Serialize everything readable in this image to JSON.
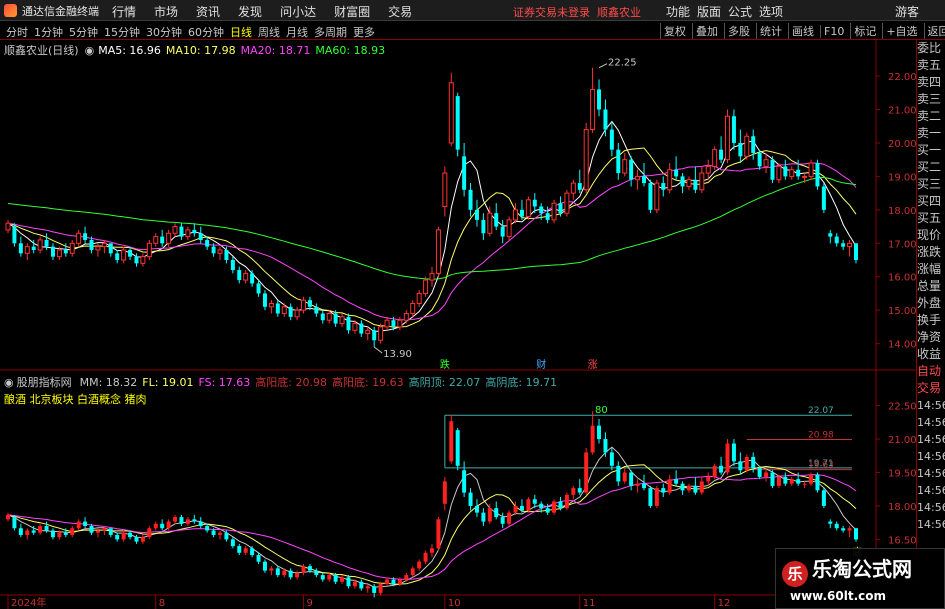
{
  "app": {
    "name": "通达信金融终端",
    "notice": "证券交易未登录",
    "stock_link": "顺鑫农业",
    "guest": "游客"
  },
  "menu": [
    "行情",
    "市场",
    "资讯",
    "发现",
    "问小达",
    "财富圈",
    "交易"
  ],
  "right_menu": [
    "功能",
    "版面",
    "公式",
    "选项"
  ],
  "periods": [
    {
      "label": "分时",
      "on": false
    },
    {
      "label": "1分钟",
      "on": false
    },
    {
      "label": "5分钟",
      "on": false
    },
    {
      "label": "15分钟",
      "on": false
    },
    {
      "label": "30分钟",
      "on": false
    },
    {
      "label": "60分钟",
      "on": false
    },
    {
      "label": "日线",
      "on": true
    },
    {
      "label": "周线",
      "on": false
    },
    {
      "label": "月线",
      "on": false
    },
    {
      "label": "多周期",
      "on": false
    },
    {
      "label": "更多",
      "on": false
    }
  ],
  "toolbar": [
    "复权",
    "叠加",
    "多股",
    "统计",
    "画线",
    "F10",
    "标记",
    "+自选",
    "返回"
  ],
  "main_legend": {
    "title": "顺鑫农业(日线)",
    "items": [
      {
        "label": "MA5: 16.96",
        "color": "#ffffff"
      },
      {
        "label": "MA10: 17.98",
        "color": "#ffff66"
      },
      {
        "label": "MA20: 18.71",
        "color": "#ff44ff"
      },
      {
        "label": "MA60: 18.93",
        "color": "#33ff33"
      }
    ]
  },
  "indicator_legend": {
    "title": "股朋指标网",
    "items": [
      {
        "label": "MM: 18.32",
        "color": "#c8c8c8"
      },
      {
        "label": "FL: 19.01",
        "color": "#ffff66"
      },
      {
        "label": "FS: 17.63",
        "color": "#ff44ff"
      },
      {
        "label": "高阳底: 20.98",
        "color": "#c83232"
      },
      {
        "label": "高阳底: 19.63",
        "color": "#c83232"
      },
      {
        "label": "高阴顶: 22.07",
        "color": "#44aaaa"
      },
      {
        "label": "高阴底: 19.71",
        "color": "#44aaaa"
      }
    ],
    "sub": "酿酒 北京板块 白酒概念 猪肉"
  },
  "right_panel": [
    {
      "label": "委比",
      "red": false
    },
    {
      "label": "卖五",
      "red": false
    },
    {
      "label": "卖四",
      "red": false
    },
    {
      "label": "卖三",
      "red": false
    },
    {
      "label": "卖二",
      "red": false
    },
    {
      "label": "卖一",
      "red": false
    },
    {
      "label": "买一",
      "red": false
    },
    {
      "label": "买二",
      "red": false
    },
    {
      "label": "买三",
      "red": false
    },
    {
      "label": "买四",
      "red": false
    },
    {
      "label": "买五",
      "red": false
    },
    {
      "label": "现价",
      "red": false
    },
    {
      "label": "涨跌",
      "red": false
    },
    {
      "label": "涨幅",
      "red": false
    },
    {
      "label": "总量",
      "red": false
    },
    {
      "label": "外盘",
      "red": false
    },
    {
      "label": "换手",
      "red": false
    },
    {
      "label": "净资",
      "red": false
    },
    {
      "label": "收益",
      "red": false
    },
    {
      "label": "自动",
      "red": true
    },
    {
      "label": "交易",
      "red": true
    },
    {
      "label": "14:56",
      "red": false,
      "sm": true
    },
    {
      "label": "14:56",
      "red": false,
      "sm": true
    },
    {
      "label": "14:56",
      "red": false,
      "sm": true
    },
    {
      "label": "14:56",
      "red": false,
      "sm": true
    },
    {
      "label": "14:56",
      "red": false,
      "sm": true
    },
    {
      "label": "14:56",
      "red": false,
      "sm": true
    },
    {
      "label": "14:56",
      "red": false,
      "sm": true
    },
    {
      "label": "14:56",
      "red": false,
      "sm": true
    }
  ],
  "chart_data": [
    {
      "type": "candlestick",
      "title": "顺鑫农业(日线)",
      "ylim": [
        13.6,
        22.6
      ],
      "yticks": [
        14.0,
        15.0,
        16.0,
        17.0,
        18.0,
        19.0,
        20.0,
        21.0,
        22.0
      ],
      "ytick_labels": [
        "14.00",
        "15.00",
        "16.00",
        "17.00",
        "18.00",
        "19.00",
        "20.00",
        "21.00",
        "22.00"
      ],
      "x_labels": [
        {
          "i": 0,
          "text": "2024年"
        },
        {
          "i": 23,
          "text": "8"
        },
        {
          "i": 46,
          "text": "9"
        },
        {
          "i": 68,
          "text": "10"
        },
        {
          "i": 89,
          "text": "11"
        },
        {
          "i": 110,
          "text": "12"
        }
      ],
      "annotations": [
        {
          "i": 57,
          "price": 13.9,
          "text": "13.90",
          "dir": "low"
        },
        {
          "i": 92,
          "price": 22.25,
          "text": "22.25",
          "dir": "high"
        }
      ],
      "markers": [
        {
          "i": 68,
          "text": "跌",
          "color": "#33ff33"
        },
        {
          "i": 83,
          "text": "财",
          "color": "#44aaff"
        },
        {
          "i": 91,
          "text": "涨",
          "color": "#ff4a4a"
        }
      ],
      "ma_series": [
        {
          "name": "MA5",
          "color": "#ffffff",
          "period": 5
        },
        {
          "name": "MA10",
          "color": "#ffff66",
          "period": 10
        },
        {
          "name": "MA20",
          "color": "#ff44ff",
          "period": 20
        },
        {
          "name": "MA60",
          "color": "#33ff33",
          "period": 60
        }
      ],
      "ma60_seed": 18.2,
      "ohlc": [
        [
          17.4,
          17.7,
          17.3,
          17.6
        ],
        [
          17.5,
          17.6,
          16.9,
          17.0
        ],
        [
          17.0,
          17.2,
          16.6,
          16.7
        ],
        [
          16.7,
          17.0,
          16.5,
          16.9
        ],
        [
          16.9,
          17.1,
          16.7,
          16.8
        ],
        [
          16.8,
          17.2,
          16.7,
          17.1
        ],
        [
          17.1,
          17.3,
          16.8,
          16.9
        ],
        [
          16.9,
          17.0,
          16.5,
          16.6
        ],
        [
          16.6,
          16.9,
          16.5,
          16.8
        ],
        [
          16.8,
          17.0,
          16.6,
          16.7
        ],
        [
          16.7,
          17.1,
          16.6,
          17.0
        ],
        [
          17.0,
          17.4,
          16.9,
          17.3
        ],
        [
          17.3,
          17.5,
          17.0,
          17.1
        ],
        [
          17.1,
          17.2,
          16.7,
          16.8
        ],
        [
          16.8,
          17.0,
          16.6,
          16.9
        ],
        [
          16.9,
          17.1,
          16.7,
          17.0
        ],
        [
          17.0,
          17.0,
          16.6,
          16.7
        ],
        [
          16.7,
          16.8,
          16.4,
          16.5
        ],
        [
          16.5,
          16.9,
          16.4,
          16.8
        ],
        [
          16.8,
          16.9,
          16.5,
          16.6
        ],
        [
          16.6,
          16.7,
          16.3,
          16.4
        ],
        [
          16.4,
          16.7,
          16.3,
          16.6
        ],
        [
          16.6,
          17.1,
          16.5,
          17.0
        ],
        [
          17.0,
          17.3,
          16.9,
          17.2
        ],
        [
          17.2,
          17.4,
          16.9,
          17.0
        ],
        [
          17.0,
          17.4,
          16.9,
          17.3
        ],
        [
          17.3,
          17.6,
          17.2,
          17.5
        ],
        [
          17.5,
          17.6,
          17.1,
          17.2
        ],
        [
          17.2,
          17.5,
          17.1,
          17.4
        ],
        [
          17.4,
          17.6,
          17.2,
          17.3
        ],
        [
          17.3,
          17.5,
          17.0,
          17.1
        ],
        [
          17.1,
          17.2,
          16.8,
          16.9
        ],
        [
          16.9,
          17.0,
          16.6,
          16.7
        ],
        [
          16.7,
          16.9,
          16.5,
          16.8
        ],
        [
          16.8,
          16.9,
          16.4,
          16.5
        ],
        [
          16.5,
          16.6,
          16.1,
          16.2
        ],
        [
          16.2,
          16.3,
          15.8,
          15.9
        ],
        [
          15.9,
          16.2,
          15.8,
          16.1
        ],
        [
          16.1,
          16.2,
          15.7,
          15.8
        ],
        [
          15.8,
          15.9,
          15.4,
          15.5
        ],
        [
          15.5,
          15.6,
          15.0,
          15.1
        ],
        [
          15.1,
          15.3,
          14.9,
          15.2
        ],
        [
          15.2,
          15.3,
          14.8,
          14.9
        ],
        [
          14.9,
          15.2,
          14.8,
          15.1
        ],
        [
          15.1,
          15.2,
          14.7,
          14.8
        ],
        [
          14.8,
          15.1,
          14.7,
          15.0
        ],
        [
          15.0,
          15.4,
          14.9,
          15.3
        ],
        [
          15.3,
          15.4,
          15.0,
          15.1
        ],
        [
          15.1,
          15.2,
          14.8,
          14.9
        ],
        [
          14.9,
          15.0,
          14.6,
          14.7
        ],
        [
          14.7,
          15.0,
          14.6,
          14.9
        ],
        [
          14.9,
          15.0,
          14.5,
          14.6
        ],
        [
          14.6,
          14.9,
          14.5,
          14.8
        ],
        [
          14.8,
          14.9,
          14.3,
          14.4
        ],
        [
          14.4,
          14.7,
          14.3,
          14.6
        ],
        [
          14.6,
          14.7,
          14.2,
          14.3
        ],
        [
          14.3,
          14.5,
          14.1,
          14.4
        ],
        [
          14.4,
          14.5,
          13.9,
          14.1
        ],
        [
          14.1,
          14.6,
          14.0,
          14.5
        ],
        [
          14.5,
          14.8,
          14.4,
          14.7
        ],
        [
          14.7,
          14.8,
          14.4,
          14.5
        ],
        [
          14.5,
          14.8,
          14.4,
          14.7
        ],
        [
          14.7,
          15.0,
          14.6,
          14.9
        ],
        [
          14.9,
          15.3,
          14.8,
          15.2
        ],
        [
          15.2,
          15.6,
          15.1,
          15.5
        ],
        [
          15.5,
          16.0,
          15.4,
          15.9
        ],
        [
          15.9,
          16.3,
          15.7,
          16.1
        ],
        [
          16.1,
          17.5,
          16.0,
          17.4
        ],
        [
          18.1,
          19.3,
          17.8,
          19.1
        ],
        [
          20.0,
          22.1,
          19.9,
          21.8
        ],
        [
          21.4,
          21.5,
          19.6,
          19.8
        ],
        [
          19.6,
          20.0,
          18.4,
          18.6
        ],
        [
          18.6,
          18.8,
          17.8,
          18.0
        ],
        [
          18.0,
          18.3,
          17.5,
          17.7
        ],
        [
          17.7,
          17.9,
          17.1,
          17.3
        ],
        [
          17.3,
          18.1,
          17.2,
          17.9
        ],
        [
          17.9,
          18.2,
          17.4,
          17.5
        ],
        [
          17.5,
          17.7,
          17.0,
          17.2
        ],
        [
          17.2,
          17.8,
          17.1,
          17.7
        ],
        [
          17.7,
          18.2,
          17.6,
          18.0
        ],
        [
          18.0,
          18.3,
          17.7,
          17.8
        ],
        [
          17.8,
          18.4,
          17.7,
          18.3
        ],
        [
          18.3,
          18.5,
          17.9,
          18.1
        ],
        [
          18.1,
          18.2,
          17.7,
          17.9
        ],
        [
          17.9,
          18.1,
          17.6,
          17.7
        ],
        [
          17.7,
          18.3,
          17.6,
          18.2
        ],
        [
          18.2,
          18.4,
          17.8,
          17.9
        ],
        [
          17.9,
          18.6,
          17.8,
          18.5
        ],
        [
          18.5,
          18.9,
          18.3,
          18.8
        ],
        [
          18.8,
          19.2,
          18.5,
          18.6
        ],
        [
          18.6,
          20.6,
          18.5,
          20.4
        ],
        [
          20.4,
          22.25,
          20.3,
          21.6
        ],
        [
          21.6,
          21.9,
          20.8,
          21.0
        ],
        [
          21.0,
          21.3,
          20.2,
          20.4
        ],
        [
          20.4,
          20.6,
          19.6,
          19.8
        ],
        [
          19.8,
          20.0,
          18.9,
          19.1
        ],
        [
          19.1,
          19.7,
          19.0,
          19.5
        ],
        [
          19.5,
          19.6,
          18.7,
          18.9
        ],
        [
          18.9,
          19.2,
          18.6,
          19.0
        ],
        [
          19.0,
          19.4,
          18.7,
          18.8
        ],
        [
          18.8,
          18.9,
          17.9,
          18.0
        ],
        [
          18.0,
          18.9,
          17.9,
          18.8
        ],
        [
          18.8,
          19.0,
          18.4,
          18.6
        ],
        [
          18.6,
          19.4,
          18.5,
          19.2
        ],
        [
          19.2,
          19.6,
          18.9,
          19.0
        ],
        [
          19.0,
          19.1,
          18.5,
          18.7
        ],
        [
          18.7,
          19.0,
          18.6,
          18.9
        ],
        [
          18.9,
          19.3,
          18.5,
          18.6
        ],
        [
          18.6,
          19.3,
          18.5,
          19.1
        ],
        [
          19.1,
          19.5,
          18.9,
          19.3
        ],
        [
          19.3,
          19.9,
          19.2,
          19.8
        ],
        [
          19.8,
          20.2,
          19.4,
          19.5
        ],
        [
          19.5,
          21.0,
          19.4,
          20.8
        ],
        [
          20.8,
          21.0,
          19.8,
          20.0
        ],
        [
          20.0,
          20.4,
          19.4,
          19.6
        ],
        [
          19.6,
          20.3,
          19.5,
          20.2
        ],
        [
          20.2,
          20.4,
          19.5,
          19.7
        ],
        [
          19.7,
          19.8,
          19.2,
          19.3
        ],
        [
          19.3,
          19.7,
          19.1,
          19.5
        ],
        [
          19.5,
          19.6,
          18.8,
          18.9
        ],
        [
          18.9,
          19.4,
          18.8,
          19.3
        ],
        [
          19.3,
          19.5,
          18.9,
          19.0
        ],
        [
          19.0,
          19.3,
          18.9,
          19.2
        ],
        [
          19.2,
          19.5,
          18.9,
          19.0
        ],
        [
          19.0,
          19.1,
          18.8,
          19.0
        ],
        [
          19.0,
          19.5,
          18.9,
          19.4
        ],
        [
          19.4,
          19.5,
          18.6,
          18.7
        ],
        [
          18.7,
          18.8,
          17.9,
          18.0
        ],
        [
          17.3,
          17.4,
          17.0,
          17.2
        ],
        [
          17.2,
          17.3,
          16.9,
          17.0
        ],
        [
          17.0,
          17.1,
          16.8,
          16.9
        ],
        [
          16.9,
          17.1,
          16.6,
          17.0
        ],
        [
          17.0,
          17.0,
          16.4,
          16.5
        ]
      ]
    },
    {
      "type": "indicator",
      "title": "股朋指标网",
      "ylim": [
        15.8,
        23.2
      ],
      "yticks": [
        16.5,
        18.0,
        19.5,
        21.0,
        22.5
      ],
      "ytick_labels": [
        "16.50",
        "18.00",
        "19.50",
        "21.00",
        "22.50"
      ],
      "levels": [
        {
          "value": 22.07,
          "label": "22.07",
          "from": 68,
          "color": "#44aaaa"
        },
        {
          "value": 20.98,
          "label": "20.98",
          "from": 115,
          "color": "#c83232"
        },
        {
          "value": 19.71,
          "label": "19.71",
          "from": 68,
          "color": "#44aaaa"
        },
        {
          "value": 19.63,
          "label": "19.63",
          "from": 115,
          "color": "#c83232"
        }
      ],
      "labels": [
        {
          "i": 92,
          "text": "80",
          "color": "#33ff33"
        },
        {
          "i": 132,
          "text": "底",
          "color": "#ffff00"
        }
      ]
    }
  ]
}
